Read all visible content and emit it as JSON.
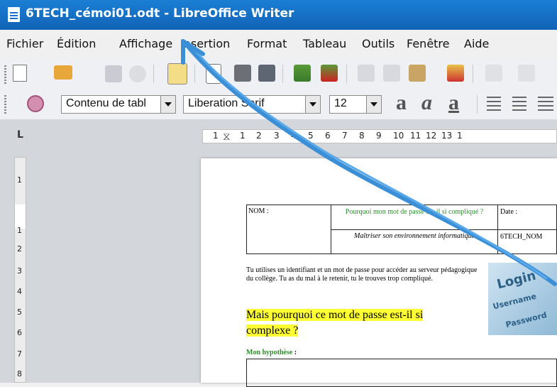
{
  "window": {
    "title": "6TECH_cémoi01.odt - LibreOffice Writer",
    "icon": "writer-document-icon"
  },
  "menu": {
    "items": [
      {
        "label": "Fichier"
      },
      {
        "label": "Édition"
      },
      {
        "label": "Affichage"
      },
      {
        "label": "Insertion"
      },
      {
        "label": "Format"
      },
      {
        "label": "Tableau"
      },
      {
        "label": "Outils"
      },
      {
        "label": "Fenêtre"
      },
      {
        "label": "Aide"
      }
    ]
  },
  "formatting": {
    "style": "Contenu de tabl",
    "font": "Liberation Serif",
    "size": "12",
    "glyph_bold": "a",
    "glyph_italic": "a",
    "glyph_underline": "a"
  },
  "ruler": {
    "corner": "L",
    "h_ticks": [
      "1",
      "1",
      "2",
      "3",
      "4",
      "5",
      "6",
      "7",
      "8",
      "9",
      "10",
      "11",
      "12",
      "13",
      "1"
    ],
    "v_ticks": [
      "1",
      "1",
      "2",
      "3",
      "4",
      "5",
      "6",
      "7",
      "8"
    ]
  },
  "document": {
    "header_table": {
      "name": "NOM",
      "name_colon": " :",
      "question": "Pourquoi mon mot de passe est-il si compliqué ?",
      "date_label": "Date",
      "date_colon": " :",
      "objective": "Maîtriser son environnement informatique",
      "code": "6TECH_NOM"
    },
    "intro": "Tu utilises un identifiant et un mot de passe pour accéder au serveur pédagogique du collège. Tu as du mal à le retenir, tu le trouves trop compliqué.",
    "headline": "Mais pourquoi ce mot de passe est-il si complexe ?",
    "hypothesis_label": "Mon hypothèse",
    "hypothesis_colon": " :",
    "login_image": {
      "title": "Login",
      "username": "Username",
      "password": "Password"
    }
  },
  "colors": {
    "titlebar": "#1a6fc6",
    "arrow": "#3a8fd6",
    "green_text": "#2e8b2e",
    "highlight": "#ffff33"
  }
}
